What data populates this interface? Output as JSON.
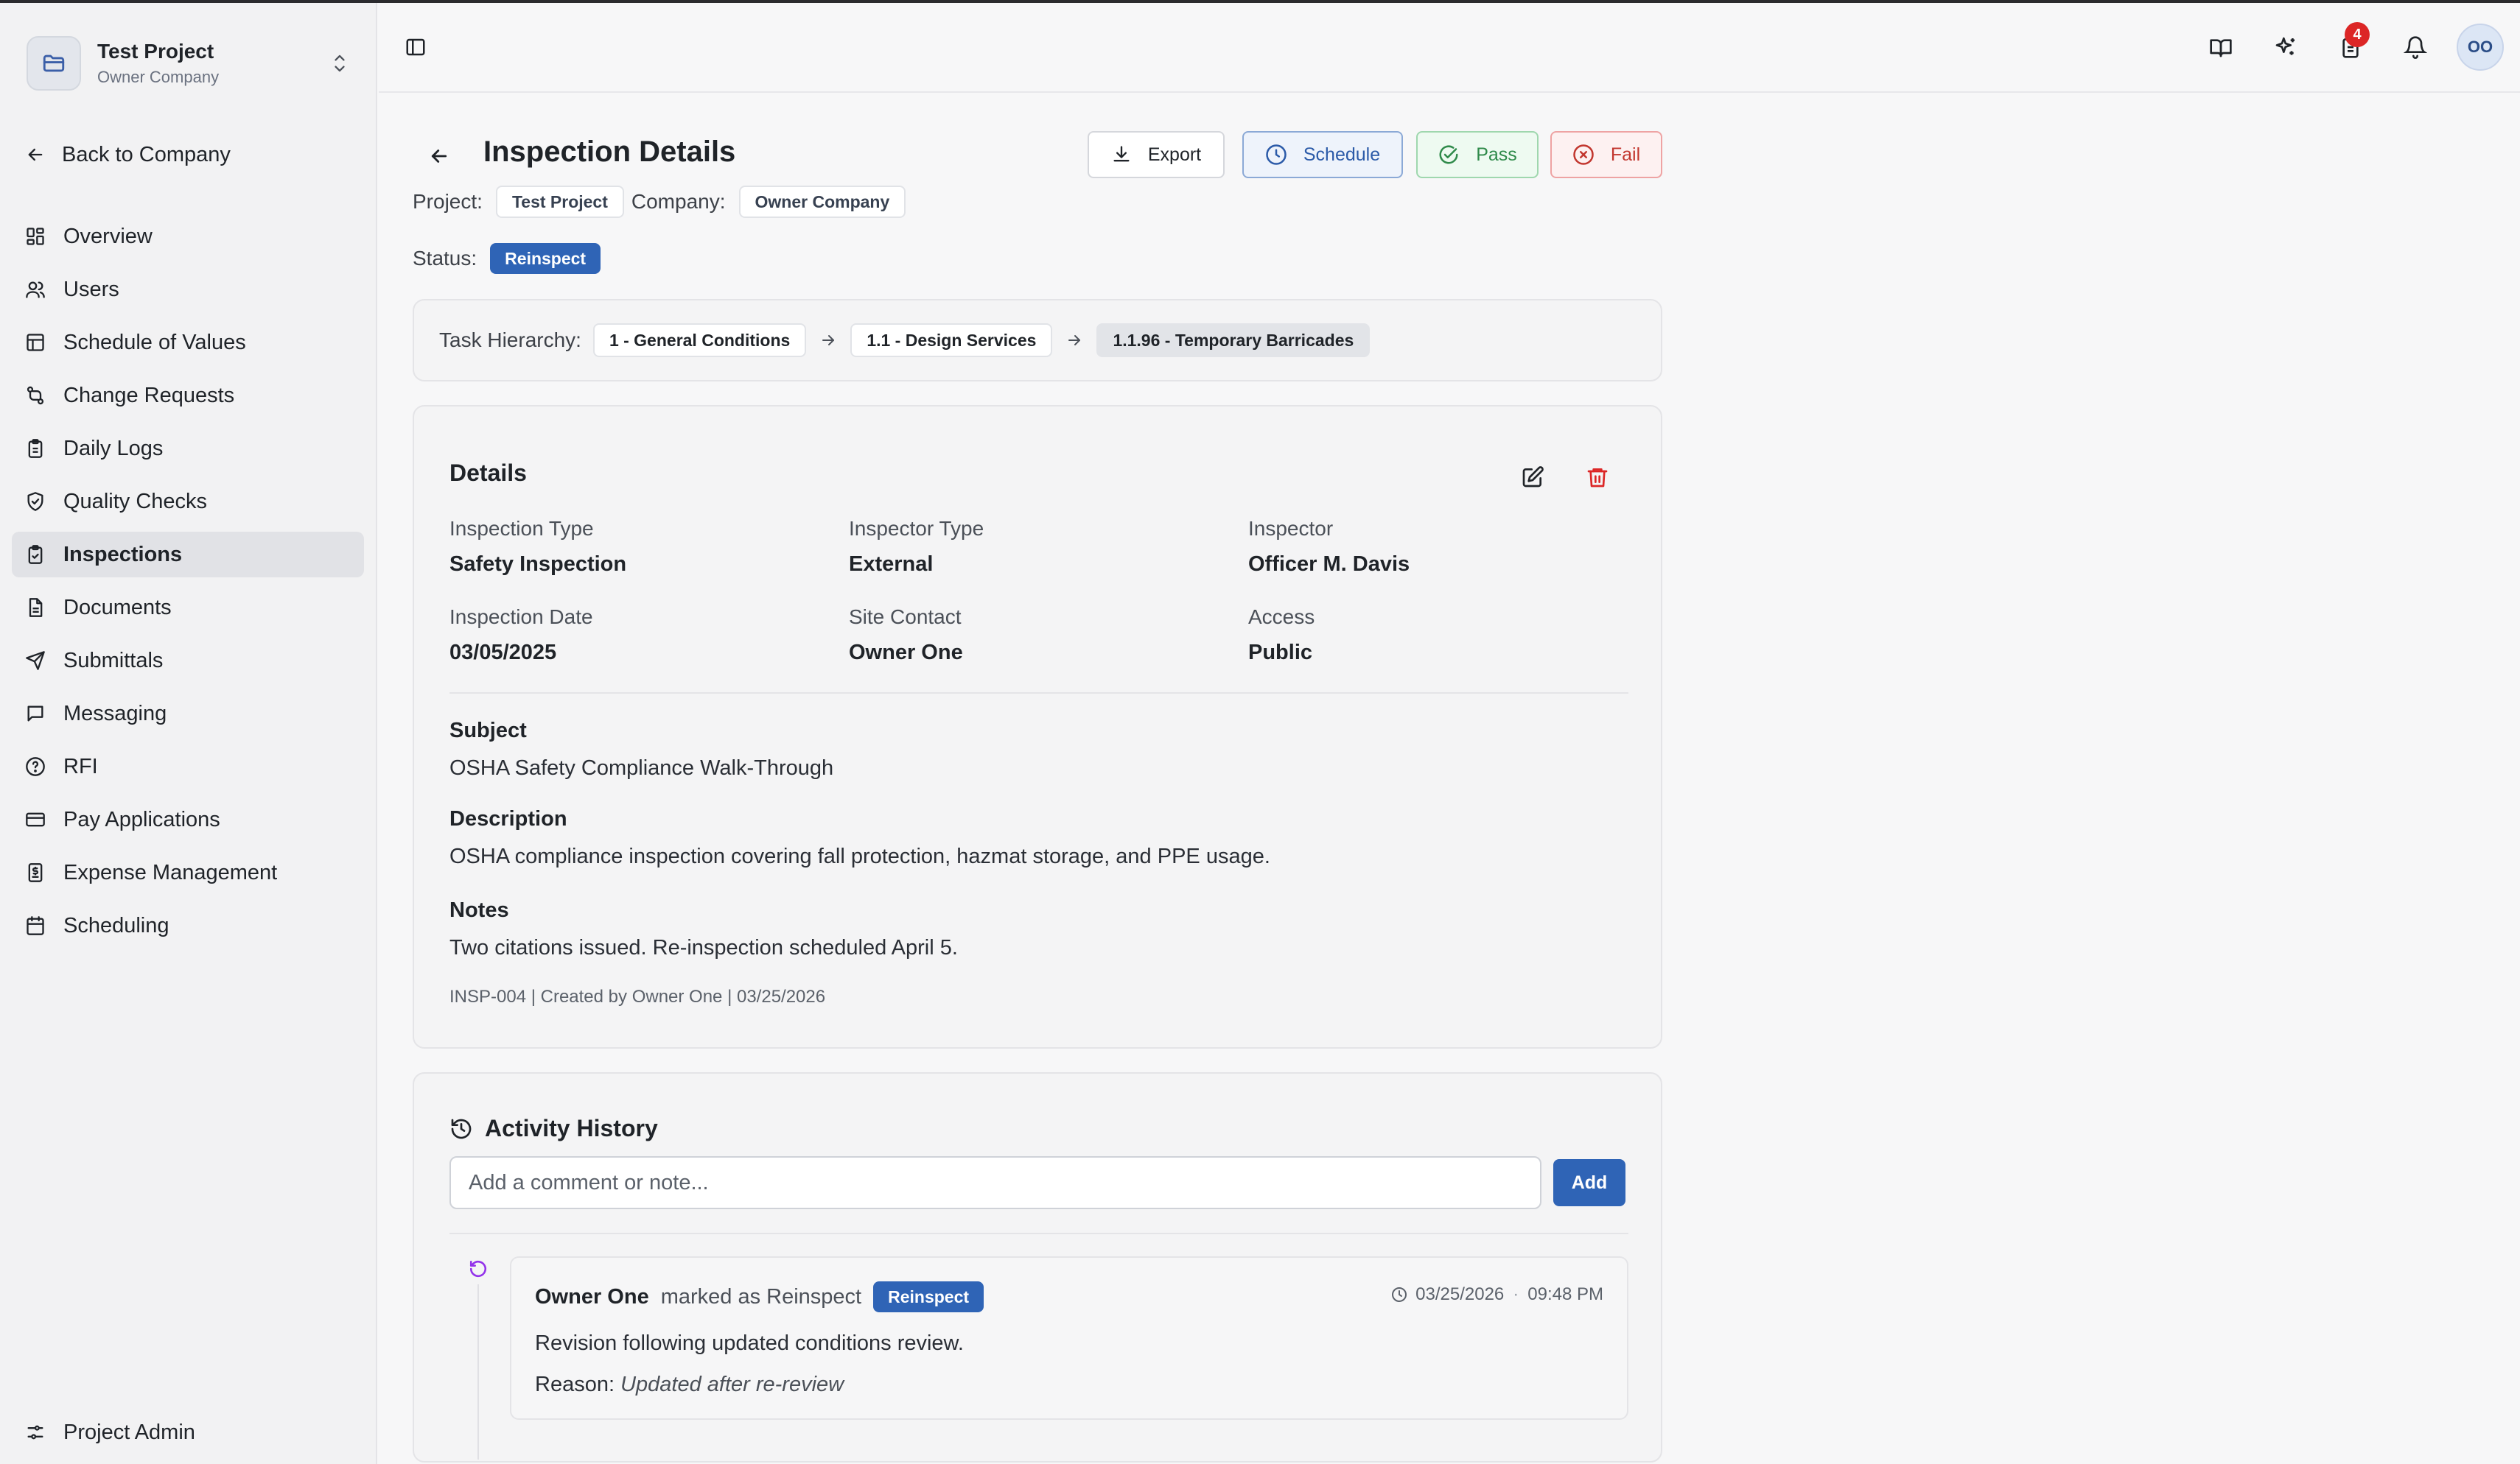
{
  "project": {
    "name": "Test Project",
    "company": "Owner Company"
  },
  "sidebar": {
    "back_label": "Back to Company",
    "items": [
      {
        "label": "Overview",
        "icon": "dashboard-icon"
      },
      {
        "label": "Users",
        "icon": "users-icon"
      },
      {
        "label": "Schedule of Values",
        "icon": "table-icon"
      },
      {
        "label": "Change Requests",
        "icon": "git-compare-icon"
      },
      {
        "label": "Daily Logs",
        "icon": "clipboard-icon"
      },
      {
        "label": "Quality Checks",
        "icon": "shield-check-icon"
      },
      {
        "label": "Inspections",
        "icon": "clipboard-check-icon",
        "active": true
      },
      {
        "label": "Documents",
        "icon": "document-icon"
      },
      {
        "label": "Submittals",
        "icon": "send-icon"
      },
      {
        "label": "Messaging",
        "icon": "message-icon"
      },
      {
        "label": "RFI",
        "icon": "help-circle-icon"
      },
      {
        "label": "Pay Applications",
        "icon": "credit-card-icon"
      },
      {
        "label": "Expense Management",
        "icon": "receipt-icon"
      },
      {
        "label": "Scheduling",
        "icon": "calendar-icon"
      }
    ],
    "bottom_item": {
      "label": "Project Admin",
      "icon": "sliders-icon"
    }
  },
  "topbar": {
    "tasks_badge": "4",
    "avatar_initials": "OO"
  },
  "header": {
    "title": "Inspection Details",
    "export_label": "Export",
    "schedule_label": "Schedule",
    "pass_label": "Pass",
    "fail_label": "Fail",
    "project_label": "Project:",
    "project_value": "Test Project",
    "company_label": "Company:",
    "company_value": "Owner Company",
    "status_label": "Status:",
    "status_value": "Reinspect"
  },
  "hierarchy": {
    "label": "Task Hierarchy:",
    "items": [
      "1 - General Conditions",
      "1.1 - Design Services",
      "1.1.96 - Temporary Barricades"
    ]
  },
  "details": {
    "title": "Details",
    "fields": {
      "inspection_type": {
        "label": "Inspection Type",
        "value": "Safety Inspection"
      },
      "inspector_type": {
        "label": "Inspector Type",
        "value": "External"
      },
      "inspector": {
        "label": "Inspector",
        "value": "Officer M. Davis"
      },
      "inspection_date": {
        "label": "Inspection Date",
        "value": "03/05/2025"
      },
      "site_contact": {
        "label": "Site Contact",
        "value": "Owner One"
      },
      "access": {
        "label": "Access",
        "value": "Public"
      }
    },
    "subject": {
      "label": "Subject",
      "value": "OSHA Safety Compliance Walk-Through"
    },
    "description": {
      "label": "Description",
      "value": "OSHA compliance inspection covering fall protection, hazmat storage, and PPE usage."
    },
    "notes": {
      "label": "Notes",
      "value": "Two citations issued. Re-inspection scheduled April 5."
    },
    "footer": "INSP-004 | Created by Owner One | 03/25/2026"
  },
  "activity": {
    "title": "Activity History",
    "input_placeholder": "Add a comment or note...",
    "add_label": "Add",
    "entries": [
      {
        "user": "Owner One",
        "action": "marked as Reinspect",
        "badge": "Reinspect",
        "date": "03/25/2026",
        "separator": "·",
        "time": "09:48 PM",
        "text": "Revision following updated conditions review.",
        "reason_label": "Reason:",
        "reason_value": "Updated after re-review"
      }
    ]
  },
  "colors": {
    "primary": "#2f64b6",
    "danger": "#dc2626",
    "success": "#2f8a4a",
    "sidebar_bg": "#f2f2f3"
  }
}
